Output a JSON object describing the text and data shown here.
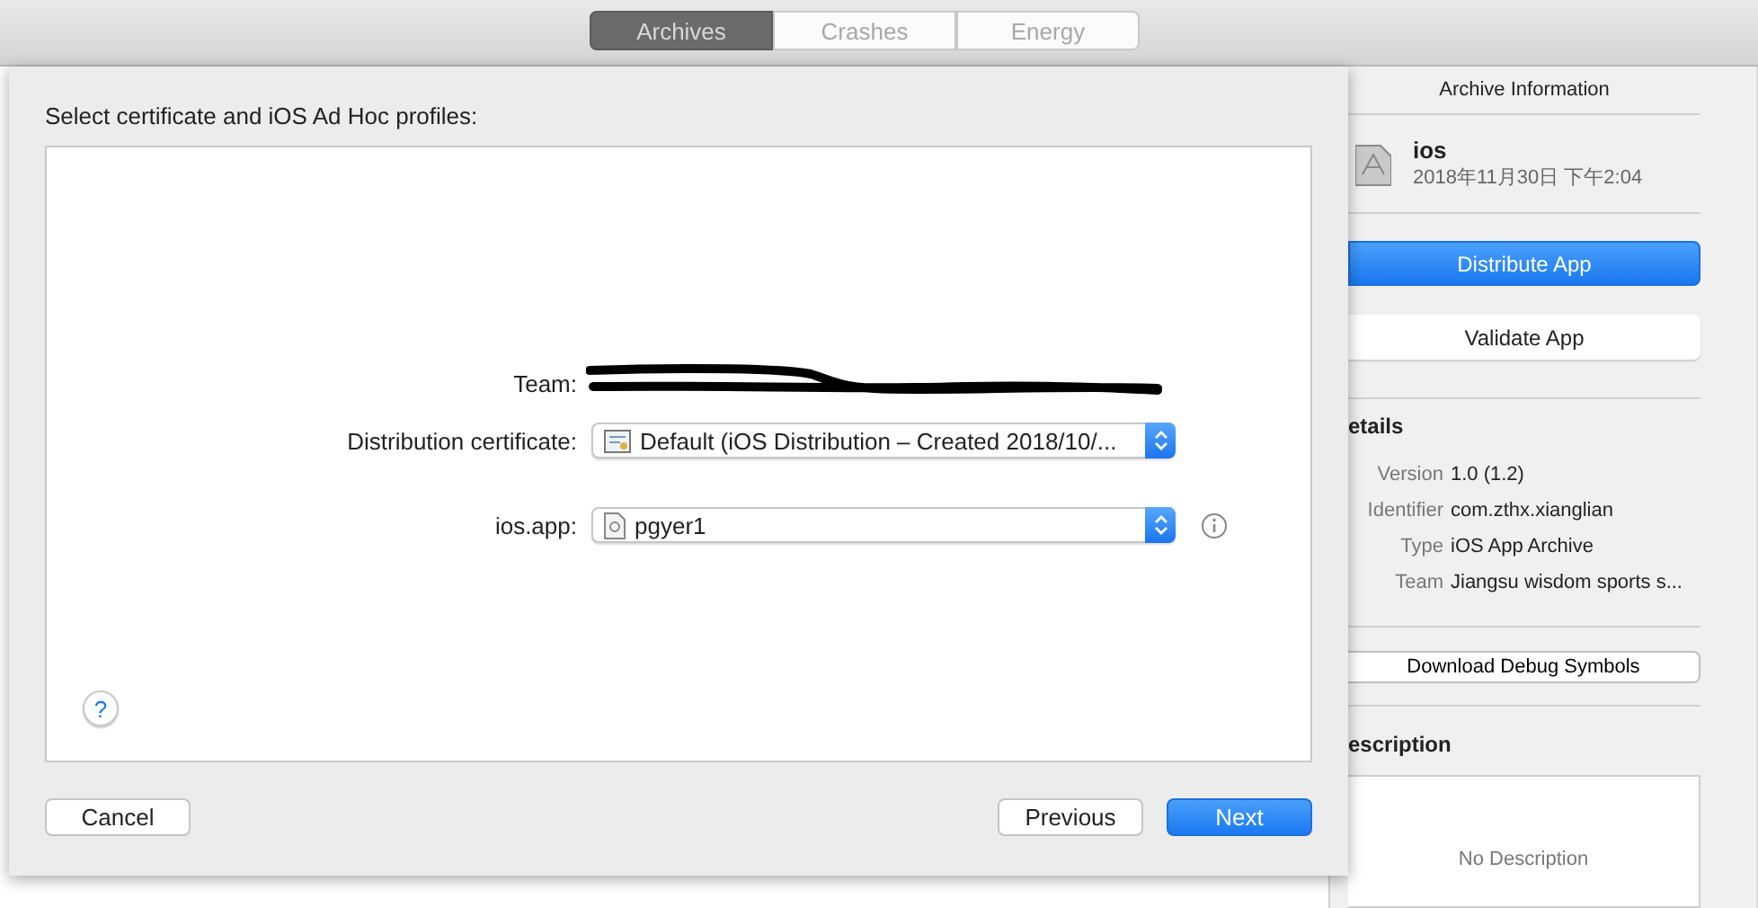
{
  "toolbar": {
    "tabs": [
      {
        "label": "Archives",
        "selected": true
      },
      {
        "label": "Crashes",
        "selected": false
      },
      {
        "label": "Energy",
        "selected": false
      }
    ]
  },
  "sheet": {
    "title": "Select certificate and iOS Ad Hoc profiles:",
    "fields": [
      {
        "kind": "text",
        "label": "Team:",
        "redacted": true
      },
      {
        "kind": "popup",
        "label": "Distribution certificate:",
        "value": "Default (iOS Distribution – Created 2018/10/...",
        "info": false
      },
      {
        "kind": "popup",
        "label": "ios.app:",
        "value": "pgyer1",
        "info": true
      }
    ],
    "help": "?",
    "buttons": [
      {
        "label": "Cancel",
        "primary": false
      },
      {
        "label": "Previous",
        "primary": false
      },
      {
        "label": "Next",
        "primary": true
      }
    ]
  },
  "inspector": {
    "title": "Archive Information",
    "archive": {
      "name": "ios",
      "date": "2018年11月30日 下午2:04"
    },
    "actions": [
      {
        "label": "Distribute App",
        "primary": true
      },
      {
        "label": "Validate App",
        "primary": false
      }
    ],
    "details_heading": "etails",
    "details": [
      {
        "key": "Version",
        "value": "1.0 (1.2)"
      },
      {
        "key": "Identifier",
        "value": "com.zthx.xianglian"
      },
      {
        "key": "Type",
        "value": "iOS App Archive"
      },
      {
        "key": "Team",
        "value": "Jiangsu wisdom sports s..."
      }
    ],
    "debug_button": "Download Debug Symbols",
    "description_heading": "escription",
    "description_placeholder": "No Description"
  }
}
